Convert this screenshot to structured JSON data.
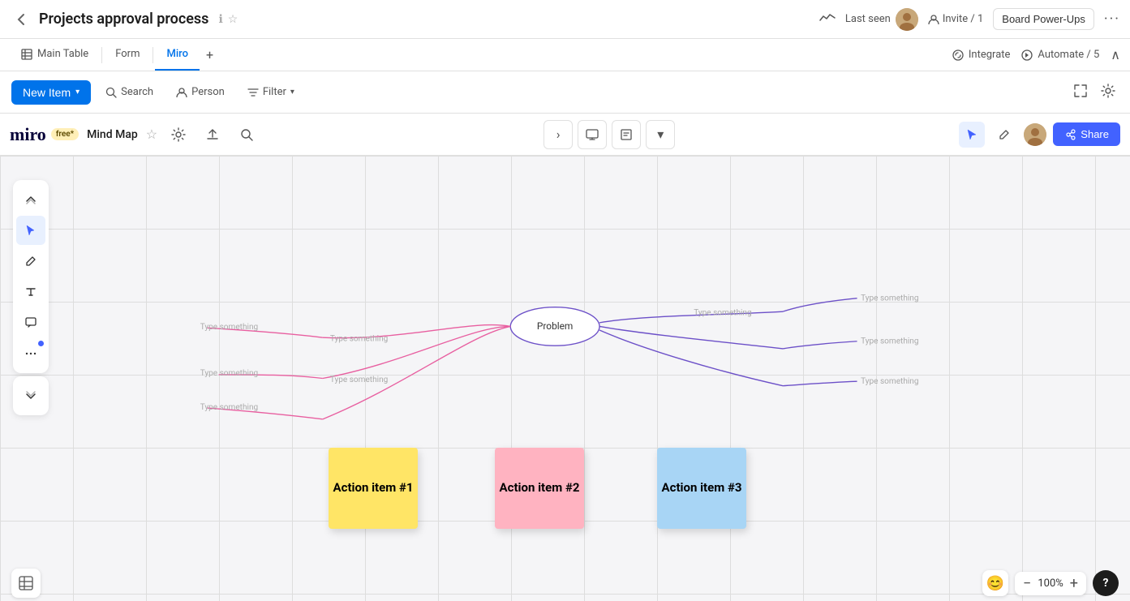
{
  "header": {
    "title": "Projects approval process",
    "info_icon": "ℹ",
    "star_icon": "☆",
    "analytics_icon": "〜",
    "last_seen_label": "Last seen",
    "invite_label": "Invite / 1",
    "board_power_ups_label": "Board Power-Ups",
    "more_icon": "···"
  },
  "tabs": {
    "items": [
      {
        "label": "Main Table",
        "icon": "⊞",
        "active": false
      },
      {
        "label": "Form",
        "icon": "",
        "active": false
      },
      {
        "label": "Miro",
        "icon": "",
        "active": true
      }
    ],
    "add_icon": "+",
    "integrate_label": "Integrate",
    "automate_label": "Automate / 5",
    "collapse_icon": "∧"
  },
  "toolbar": {
    "new_item_label": "New Item",
    "search_label": "Search",
    "person_label": "Person",
    "filter_label": "Filter",
    "expand_icon": "⛶",
    "settings_icon": "⚙"
  },
  "miro": {
    "logo": "miro",
    "free_badge": "free*",
    "board_name": "Mind Map",
    "star_icon": "☆",
    "share_label": "Share",
    "zoom_percent": "100%",
    "problem_node": "Problem",
    "mind_map_nodes": [
      "Type something",
      "Type something",
      "Type something",
      "Type something",
      "Type something",
      "Type something",
      "Type something",
      "Type something"
    ],
    "sticky_notes": [
      {
        "label": "Action item #1",
        "color": "yellow"
      },
      {
        "label": "Action item #2",
        "color": "pink"
      },
      {
        "label": "Action item #3",
        "color": "blue"
      }
    ]
  }
}
